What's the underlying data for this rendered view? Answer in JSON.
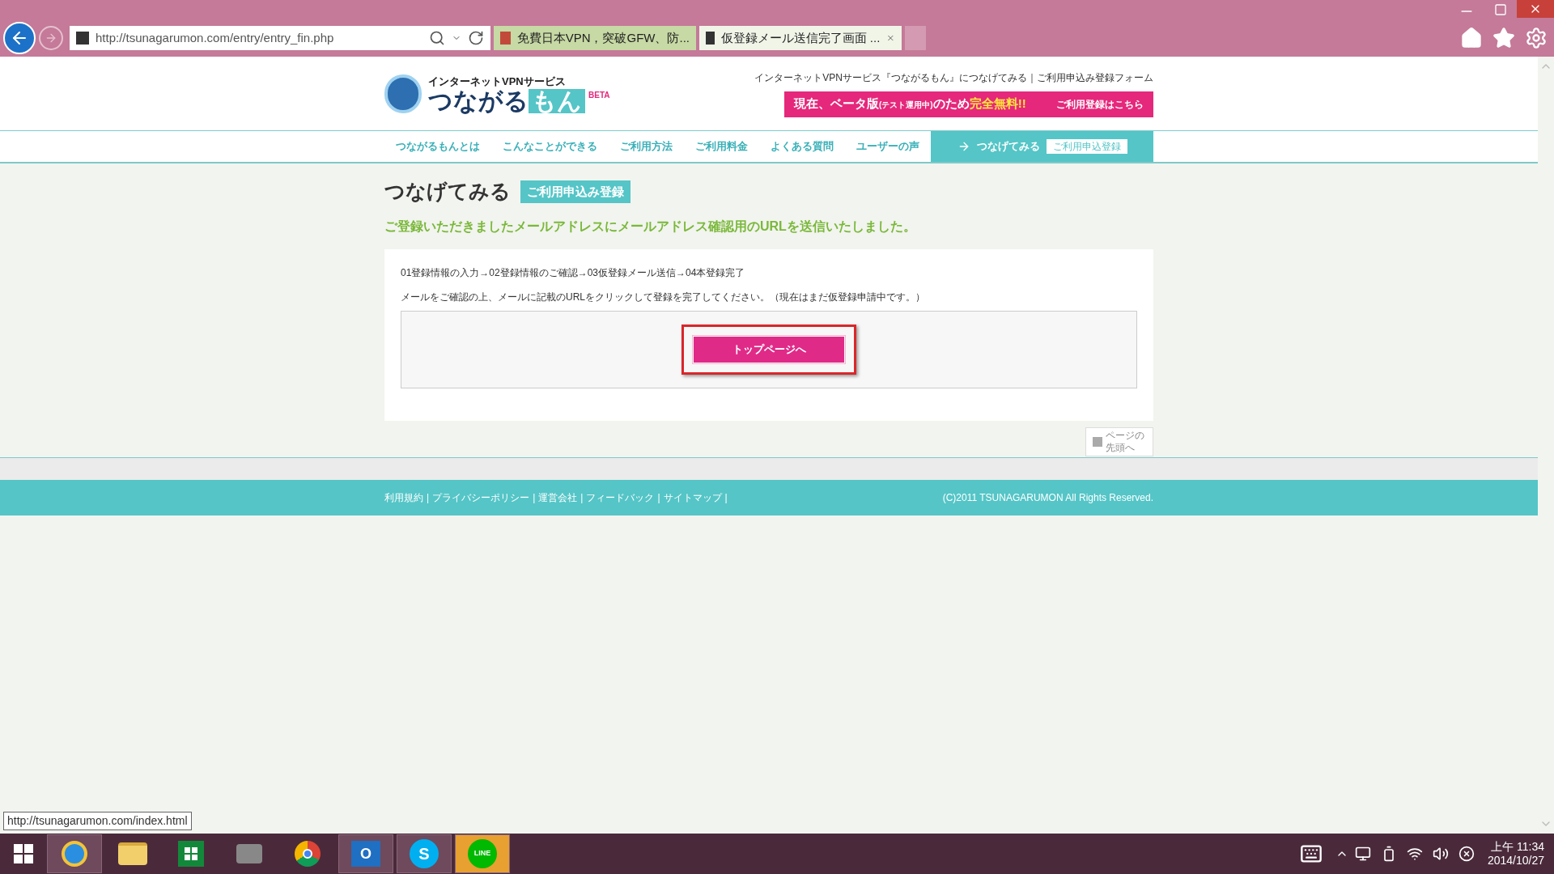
{
  "browser": {
    "address": "http://tsunagarumon.com/entry/entry_fin.php",
    "tabs": [
      {
        "label": "免費日本VPN，突破GFW、防...",
        "selected": false,
        "closable": false
      },
      {
        "label": "仮登録メール送信完了画面 ...",
        "selected": true,
        "closable": true
      }
    ]
  },
  "header": {
    "logo_tagline": "インターネットVPNサービス",
    "logo_name_1": "つながる",
    "logo_name_2": "もん",
    "logo_badge": "BETA",
    "breadcrumb": "インターネットVPNサービス『つながるもん』につなげてみる｜ご利用申込み登録フォーム",
    "banner": {
      "part_1": "現在、ベータ版",
      "part_2": "(テスト運用中)",
      "part_3": "のため",
      "part_4": "完全無料!!",
      "link": "ご利用登録はこちら"
    }
  },
  "nav": {
    "items": [
      {
        "label": "つながるもんとは",
        "selected": false
      },
      {
        "label": "こんなことができる",
        "selected": false
      },
      {
        "label": "ご利用方法",
        "selected": false
      },
      {
        "label": "ご利用料金",
        "selected": false
      },
      {
        "label": "よくある質問",
        "selected": false
      },
      {
        "label": "ユーザーの声",
        "selected": false
      }
    ],
    "cta": {
      "label": "つなげてみる",
      "badge": "ご利用申込登録",
      "selected": true
    }
  },
  "page": {
    "title": "つなげてみる",
    "title_badge": "ご利用申込み登録",
    "message": "ご登録いただきましたメールアドレスにメールアドレス確認用のURLを送信いたしました。",
    "steps": "01登録情報の入力→02登録情報のご確認→03仮登録メール送信→04本登録完了",
    "instruction": "メールをご確認の上、メールに記載のURLをクリックして登録を完了してください。（現在はまだ仮登録申請中です。）",
    "button": "トップページへ",
    "button_highlighted": true,
    "page_top": "ページの先頭へ"
  },
  "footer": {
    "separator": "|",
    "links": [
      "利用規約",
      "プライバシーポリシー",
      "運営会社",
      "フィードバック",
      "サイトマップ"
    ],
    "copyright": "(C)2011 TSUNAGARUMON All Rights Reserved."
  },
  "status_url": "http://tsunagarumon.com/index.html",
  "taskbar": {
    "apps": [
      {
        "kind": "ie",
        "active": true
      },
      {
        "kind": "folder",
        "active": false
      },
      {
        "kind": "store",
        "active": false
      },
      {
        "kind": "tool",
        "active": false
      },
      {
        "kind": "chrome",
        "active": false
      },
      {
        "kind": "outlook",
        "active": true,
        "label": "O"
      },
      {
        "kind": "skype",
        "active": true,
        "label": "S"
      },
      {
        "kind": "line",
        "active": true,
        "label": "LINE"
      }
    ],
    "time": "上午 11:34",
    "date": "2014/10/27"
  }
}
